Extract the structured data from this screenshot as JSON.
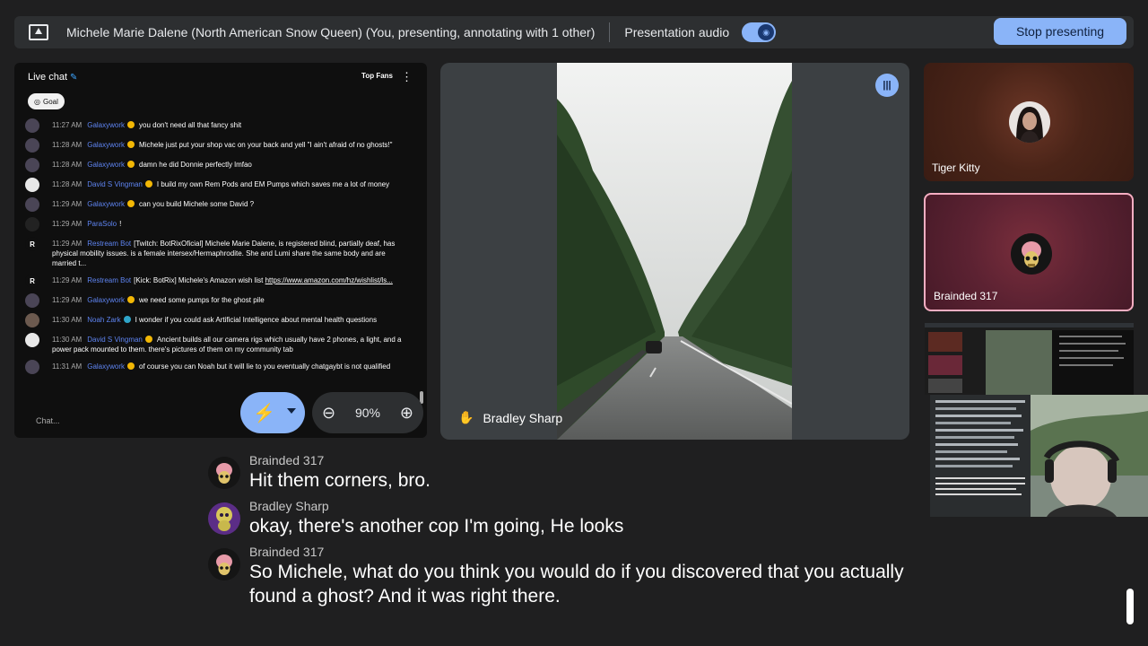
{
  "topbar": {
    "title": "Michele Marie Dalene (North American Snow Queen) (You, presenting, annotating with 1 other)",
    "audio_label": "Presentation audio",
    "stop_label": "Stop presenting"
  },
  "chat": {
    "header": "Live chat",
    "top_fans": "Top Fans",
    "goal": "Goal",
    "input_placeholder": "Chat...",
    "messages": [
      {
        "time": "11:27 AM",
        "author": "Galaxywork",
        "text": "you don't need all that fancy shit"
      },
      {
        "time": "11:28 AM",
        "author": "Galaxywork",
        "text": "Michele just put your shop vac on your back and yell \"I ain't afraid of no ghosts!\""
      },
      {
        "time": "11:28 AM",
        "author": "Galaxywork",
        "text": "damn he did Donnie perfectly lmfao"
      },
      {
        "time": "11:28 AM",
        "author": "David S Vingman",
        "text": "I build my own Rem Pods and EM Pumps which saves me a lot of money"
      },
      {
        "time": "11:29 AM",
        "author": "Galaxywork",
        "text": "can you build Michele some David ?"
      },
      {
        "time": "11:29 AM",
        "author": "ParaSolo",
        "text": "!"
      },
      {
        "time": "11:29 AM",
        "author": "Restream Bot",
        "text": "[Twitch: BotRixOficial] Michele Marie Dalene, is registered blind, partially deaf, has physical mobility issues. is a female intersex/Hermaphrodite. She and Lumi share the same body and are married t..."
      },
      {
        "time": "11:29 AM",
        "author": "Restream Bot",
        "text": "[Kick: BotRix] Michele's Amazon wish list ",
        "link": "https://www.amazon.com/hz/wishlist/ls..."
      },
      {
        "time": "11:29 AM",
        "author": "Galaxywork",
        "text": "we need some pumps for the ghost pile"
      },
      {
        "time": "11:30 AM",
        "author": "Noah Zark",
        "text": "I wonder if you could ask Artificial Intelligence about mental health questions"
      },
      {
        "time": "11:30 AM",
        "author": "David S Vingman",
        "text": "Ancient builds all our camera rigs which usually have 2 phones, a light, and a power pack mounted to them. there's pictures of them on my community tab"
      },
      {
        "time": "11:31 AM",
        "author": "Galaxywork",
        "text": "of course you can Noah but it will lie to you eventually chatgaybt is not qualified"
      }
    ]
  },
  "zoom": {
    "level": "90%"
  },
  "main_tile": {
    "name": "Bradley Sharp"
  },
  "participants": [
    {
      "name": "Tiger Kitty"
    },
    {
      "name": "Brainded 317"
    }
  ],
  "captions": [
    {
      "speaker": "Brainded 317",
      "text": "Hit them corners, bro."
    },
    {
      "speaker": "Bradley Sharp",
      "text": "okay, there's another cop I'm going, He looks"
    },
    {
      "speaker": "Brainded 317",
      "text": "So Michele, what do you think you would do if you discovered that you actually found a ghost? And it was right there."
    }
  ],
  "colors": {
    "accent": "#8ab4f8",
    "highlight_border": "#f6aec2",
    "author": "#5e84f1"
  },
  "icons": [
    "present-screen-icon",
    "audio-toggle-icon",
    "pin-icon",
    "kebab-menu-icon",
    "annotate-icon",
    "zoom-out-icon",
    "zoom-in-icon",
    "speaking-indicator-icon",
    "hand-raise-icon"
  ]
}
